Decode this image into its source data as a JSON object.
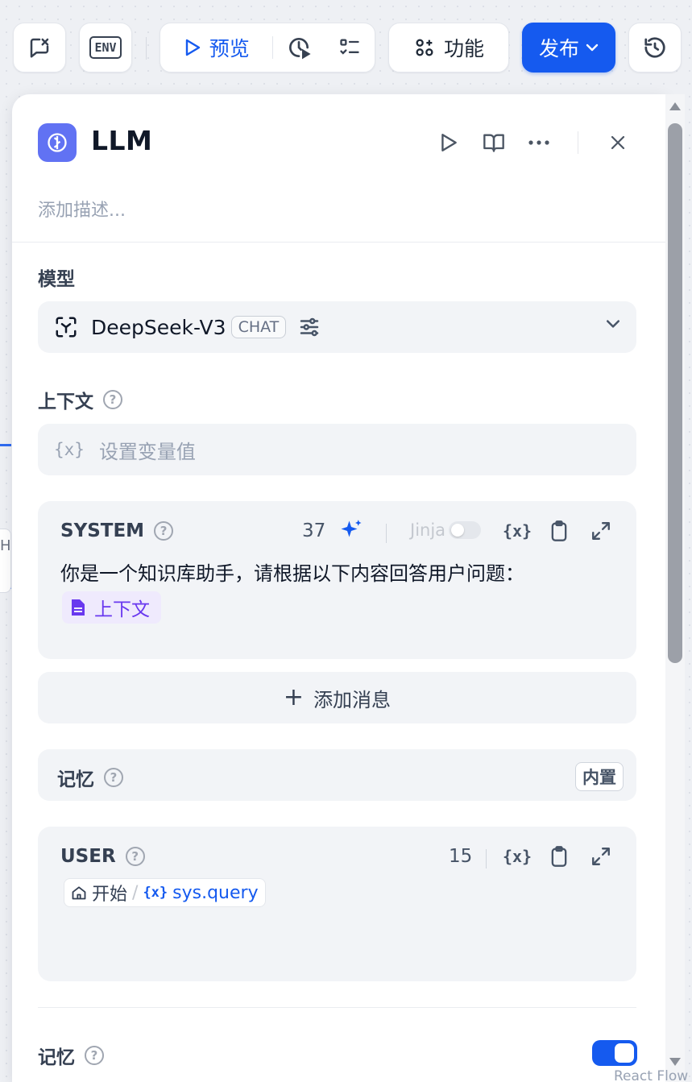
{
  "toolbar": {
    "preview_label": "预览",
    "feature_label": "功能",
    "publish_label": "发布",
    "env_label": "ENV"
  },
  "node": {
    "title": "LLM",
    "description_placeholder": "添加描述..."
  },
  "model": {
    "section_label": "模型",
    "name": "DeepSeek-V3",
    "mode_badge": "CHAT"
  },
  "context": {
    "section_label": "上下文",
    "placeholder": "设置变量值"
  },
  "system_prompt": {
    "role": "SYSTEM",
    "char_count": "37",
    "jinja_label": "Jinja",
    "text": "你是一个知识库助手，请根据以下内容回答用户问题：",
    "context_chip": "上下文"
  },
  "add_message_label": "添加消息",
  "memory_row": {
    "label": "记忆",
    "badge": "内置"
  },
  "user_prompt": {
    "role": "USER",
    "char_count": "15",
    "chip_node": "开始",
    "chip_var": "sys.query"
  },
  "memory_toggle": {
    "label": "记忆",
    "enabled": true
  },
  "canvas": {
    "left_node_text": "HA",
    "flow_label": "React Flow"
  },
  "colors": {
    "accent": "#155aef",
    "node_icon_bg": "#6172f3",
    "context_chip": "#6938ef"
  }
}
